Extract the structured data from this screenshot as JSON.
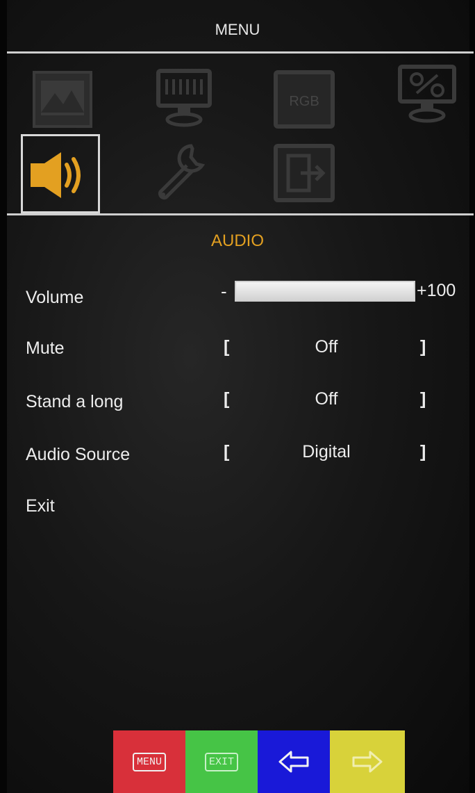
{
  "menu": {
    "title": "MENU"
  },
  "icons": [
    {
      "name": "picture-icon",
      "selected": false
    },
    {
      "name": "display-icon",
      "selected": false
    },
    {
      "name": "rgb-icon",
      "label": "RGB",
      "selected": false
    },
    {
      "name": "display-settings-icon",
      "selected": false
    },
    {
      "name": "audio-icon",
      "selected": true
    },
    {
      "name": "wrench-icon",
      "selected": false
    },
    {
      "name": "exit-input-icon",
      "selected": false
    }
  ],
  "section": {
    "title": "AUDIO"
  },
  "rows": [
    {
      "label": "Volume",
      "min_label": "-",
      "value_label": "+100",
      "level_percent": 100
    },
    {
      "label": "Mute",
      "open": "[",
      "value": "Off",
      "close": "]"
    },
    {
      "label": "Stand a long",
      "open": "[",
      "value": "Off",
      "close": "]"
    },
    {
      "label": "Audio Source",
      "open": "[",
      "value": "Digital",
      "close": "]"
    },
    {
      "label": "Exit"
    }
  ],
  "buttons": [
    {
      "label": "MENU",
      "color": "#d8303a"
    },
    {
      "label": "EXIT",
      "color": "#46c446"
    },
    {
      "icon": "arrow-left-icon",
      "color": "#1919d8"
    },
    {
      "icon": "arrow-right-icon",
      "color": "#d8d23a"
    }
  ],
  "colors": {
    "accent": "#e3a021",
    "text": "#ededed",
    "background": "#161616"
  }
}
